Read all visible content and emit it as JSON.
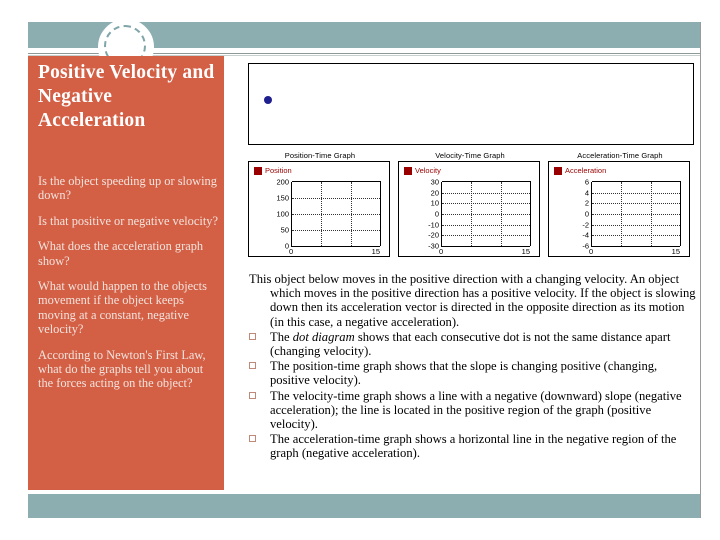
{
  "slide": {
    "title": "Positive Velocity and Negative Acceleration",
    "colors": {
      "header_band": "#8caeb1",
      "sidebar": "#d35f45",
      "footer_band": "#8caeb1",
      "legend_text": "#990000",
      "dot_point": "#1f1f8f",
      "bullet_outline": "#c08878"
    }
  },
  "sidebar": {
    "questions": [
      "Is the object speeding up or slowing down?",
      "Is that positive or negative velocity?",
      "What does the acceleration graph show?",
      "What would happen to the objects movement if the object keeps moving at a constant, negative velocity?",
      "According to Newton's First Law, what do the graphs tell you about the forces acting on the object?"
    ]
  },
  "dot_diagram": {
    "name": "dot-diagram",
    "dots": 1
  },
  "body": {
    "lead": "This object below moves in the positive direction with a changing velocity. An object which moves in the positive direction has a positive velocity. If the object is slowing down then its acceleration vector is directed in the opposite direction as its motion (in this case, a negative acceleration).",
    "bullets": [
      {
        "pre": "The ",
        "italic": "dot diagram",
        "post": " shows that each consecutive dot is not the same distance apart (changing velocity)."
      },
      {
        "pre": "The position-time graph shows that the slope is changing positive (changing, positive velocity).",
        "italic": "",
        "post": ""
      },
      {
        "pre": "The velocity-time graph shows a line with a negative (downward) slope (negative acceleration); the line is located in the positive region of the graph (positive velocity).",
        "italic": "",
        "post": ""
      },
      {
        "pre": "The acceleration-time graph shows a horizontal line in the negative region of the graph (negative acceleration).",
        "italic": "",
        "post": ""
      }
    ]
  },
  "chart_data": [
    {
      "type": "line",
      "title": "Position-Time Graph",
      "legend": [
        "Position"
      ],
      "legend_position": "top-left",
      "grid": true,
      "xlabel": "",
      "ylabel": "",
      "xlim": [
        0,
        15
      ],
      "ylim": [
        0,
        200
      ],
      "xticks": [
        0,
        15
      ],
      "yticks": [
        0,
        50,
        100,
        150,
        200
      ],
      "series": [
        {
          "name": "Position",
          "x": [],
          "values": []
        }
      ]
    },
    {
      "type": "line",
      "title": "Velocity-Time Graph",
      "legend": [
        "Velocity"
      ],
      "legend_position": "top-left",
      "grid": true,
      "xlabel": "",
      "ylabel": "",
      "xlim": [
        0,
        15
      ],
      "ylim": [
        -30,
        30
      ],
      "xticks": [
        0,
        15
      ],
      "yticks": [
        -30,
        -20,
        -10,
        0,
        10,
        20,
        30
      ],
      "series": [
        {
          "name": "Velocity",
          "x": [],
          "values": []
        }
      ]
    },
    {
      "type": "line",
      "title": "Acceleration-Time Graph",
      "legend": [
        "Acceleration"
      ],
      "legend_position": "top-left",
      "grid": true,
      "xlabel": "",
      "ylabel": "",
      "xlim": [
        0,
        15
      ],
      "ylim": [
        -6,
        6
      ],
      "xticks": [
        0,
        15
      ],
      "yticks": [
        -6,
        -4,
        -2,
        0,
        2,
        4,
        6
      ],
      "series": [
        {
          "name": "Acceleration",
          "x": [],
          "values": []
        }
      ]
    }
  ]
}
